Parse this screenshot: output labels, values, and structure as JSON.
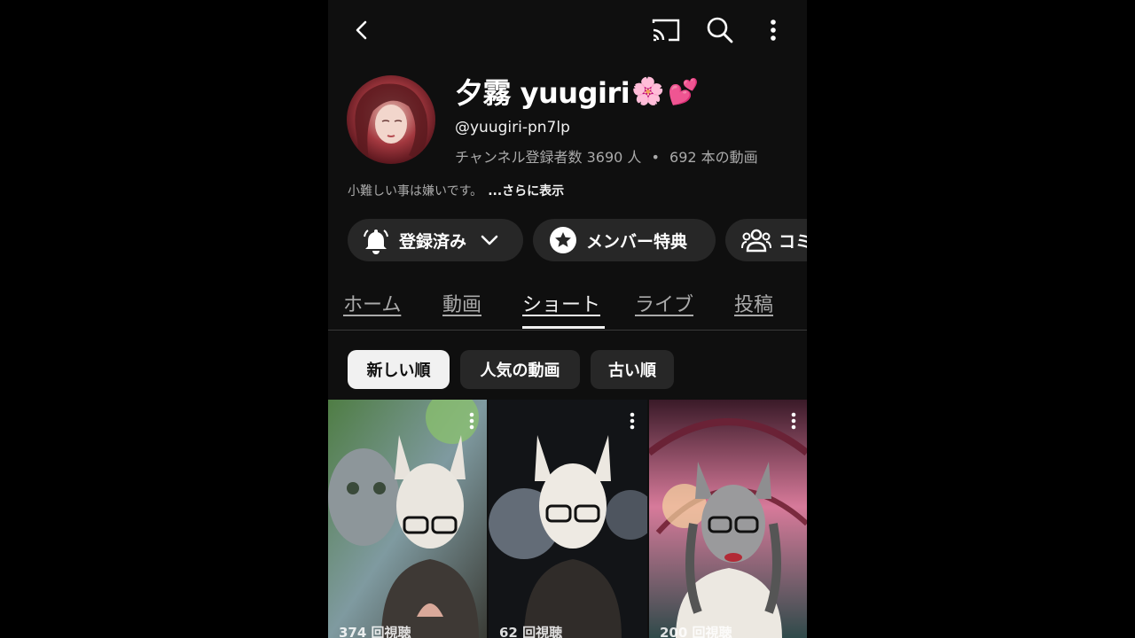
{
  "topbar": {
    "back_icon": "back-arrow-icon",
    "cast_icon": "cast-icon",
    "search_icon": "search-icon",
    "more_icon": "more-vert-icon"
  },
  "channel": {
    "name": "夕霧 yuugiri",
    "name_emoji_1": "🌸",
    "name_emoji_2": "💕",
    "handle": "@yuugiri-pn7lp",
    "subscribers": "チャンネル登録者数 3690 人",
    "separator": "•",
    "video_count": "692 本の動画",
    "description": "小難しい事は嫌いです。",
    "more_link": "...さらに表示"
  },
  "actions": {
    "subscribed_label": "登録済み",
    "member_label": "メンバー特典",
    "community_label": "コミ"
  },
  "tabs": [
    {
      "label": "ホーム",
      "active": false
    },
    {
      "label": "動画",
      "active": false
    },
    {
      "label": "ショート",
      "active": true
    },
    {
      "label": "ライブ",
      "active": false
    },
    {
      "label": "投稿",
      "active": false
    }
  ],
  "sort_chips": [
    {
      "label": "新しい順",
      "selected": true
    },
    {
      "label": "人気の動画",
      "selected": false
    },
    {
      "label": "古い順",
      "selected": false
    }
  ],
  "shorts": [
    {
      "views": "374 回視聴"
    },
    {
      "views": "62 回視聴"
    },
    {
      "views": "200 回視聴"
    }
  ],
  "colors": {
    "background": "#0f0f0f",
    "chip_bg": "#272727",
    "secondary_text": "#aaaaaa",
    "selected_chip": "#f1f1f1"
  }
}
